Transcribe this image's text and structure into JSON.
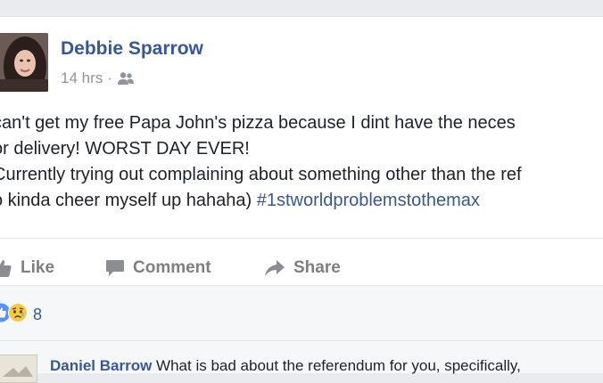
{
  "post": {
    "author": "Debbie Sparrow",
    "time": "14 hrs",
    "separator": "·",
    "audience_icon": "friends-icon",
    "text_lines": [
      "can't get my free Papa John's pizza because I dint have the neces",
      "or delivery! WORST DAY EVER!",
      "Currently trying out complaining about something other than the ref"
    ],
    "last_line_text": "o kinda cheer myself up hahaha) ",
    "hashtag": "#1stworldproblemstothemax"
  },
  "actions": {
    "like": "Like",
    "comment": "Comment",
    "share": "Share"
  },
  "reactions": {
    "types": [
      "like",
      "sad"
    ],
    "count": "8"
  },
  "comment": {
    "author": "Daniel Barrow",
    "text": "What is bad about the referendum for you, specifically,"
  },
  "colors": {
    "link_blue": "#365899",
    "like_blue": "#5890ff",
    "sad_yellow": "#f7c844",
    "muted_gray": "#90949c",
    "text": "#1d2129"
  }
}
